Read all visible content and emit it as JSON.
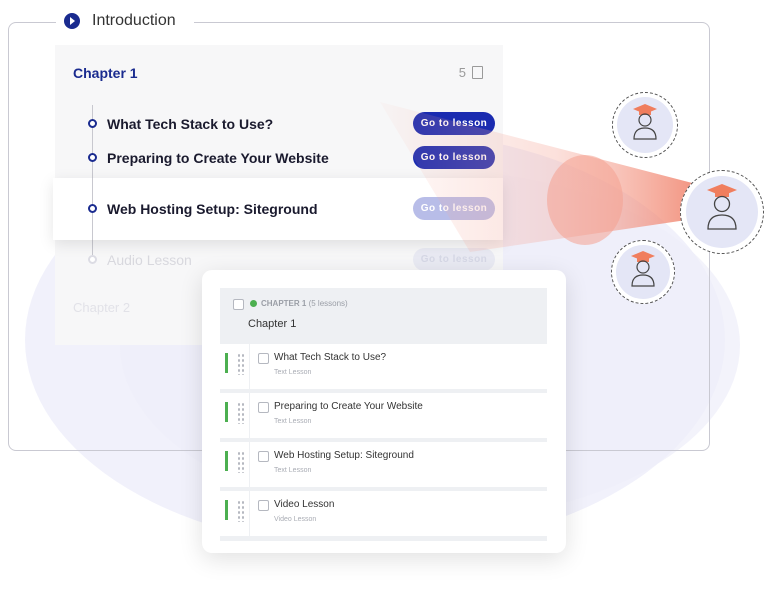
{
  "intro": {
    "title": "Introduction",
    "icon": "play-circle-icon"
  },
  "chapter": {
    "title": "Chapter 1",
    "count": "5",
    "lessons": [
      {
        "title": "What Tech Stack to Use?",
        "button": "Go to lesson"
      },
      {
        "title": "Preparing to Create Your Website",
        "button": "Go to lesson"
      },
      {
        "title": "Web Hosting Setup: Siteground",
        "button": "Go to lesson"
      },
      {
        "title": "Audio Lesson",
        "button": "Go to lesson"
      }
    ],
    "next_chapter": "Chapter 2"
  },
  "builder": {
    "chapter_label": "CHAPTER 1",
    "chapter_sub": "(5 lessons)",
    "chapter_name": "Chapter 1",
    "items": [
      {
        "title": "What Tech Stack to Use?",
        "type": "Text Lesson"
      },
      {
        "title": "Preparing to Create Your Website",
        "type": "Text Lesson"
      },
      {
        "title": "Web Hosting Setup: Siteground",
        "type": "Text Lesson"
      },
      {
        "title": "Video Lesson",
        "type": "Video Lesson"
      }
    ]
  },
  "colors": {
    "accent": "#1a2bb0",
    "green": "#4caf50",
    "beam": "#f08a78",
    "cap": "#f07e5e"
  }
}
